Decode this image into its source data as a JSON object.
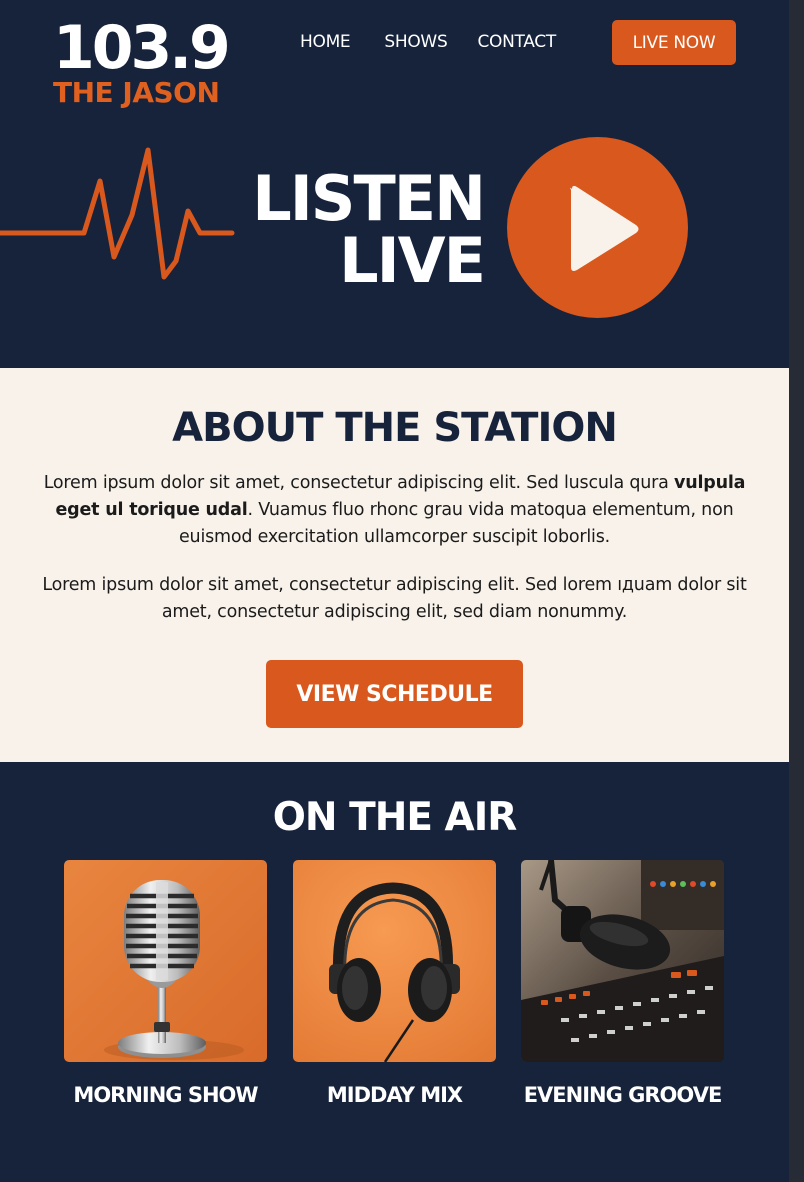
{
  "header": {
    "logo_number": "103.9",
    "logo_name": "THE JASON",
    "nav": [
      "HOME",
      "SHOWS",
      "CONTACT"
    ],
    "live_button": "LIVE NOW"
  },
  "hero": {
    "line1": "LISTEN",
    "line2": "LIVE",
    "wave_icon": "heartbeat-line-icon",
    "play_icon": "play-icon"
  },
  "about": {
    "title": "ABOUT THE STATION",
    "p1_a": "Lorem ipsum dolor sit amet, consectetur adipiscing elit. Sed luscula qura",
    "p1_bold": "vulpula eget ul torique udal",
    "p1_b": ". Vuamus fluo rhonc grau vida matoqua elementum, non euismod exercitation ullamcorper suscipit loborlis.",
    "p2": "Lorem ipsum dolor sit amet, consectetur adipiscing elit. Sed lorem ıдuam dolor sit amet, consectetur adipiscing elit, sed diam nonummy.",
    "button": "VIEW SCHEDULE"
  },
  "on_air": {
    "title": "ON THE AIR",
    "shows": [
      {
        "label": "MORNING SHOW",
        "image": "vintage-microphone"
      },
      {
        "label": "MIDDAY  MIX",
        "image": "headphones"
      },
      {
        "label": "EVENING GROOVE",
        "image": "studio-microphone-mixer"
      }
    ]
  },
  "colors": {
    "navy": "#16233b",
    "orange": "#d9581d",
    "cream": "#f8f2ea",
    "white": "#ffffff"
  }
}
